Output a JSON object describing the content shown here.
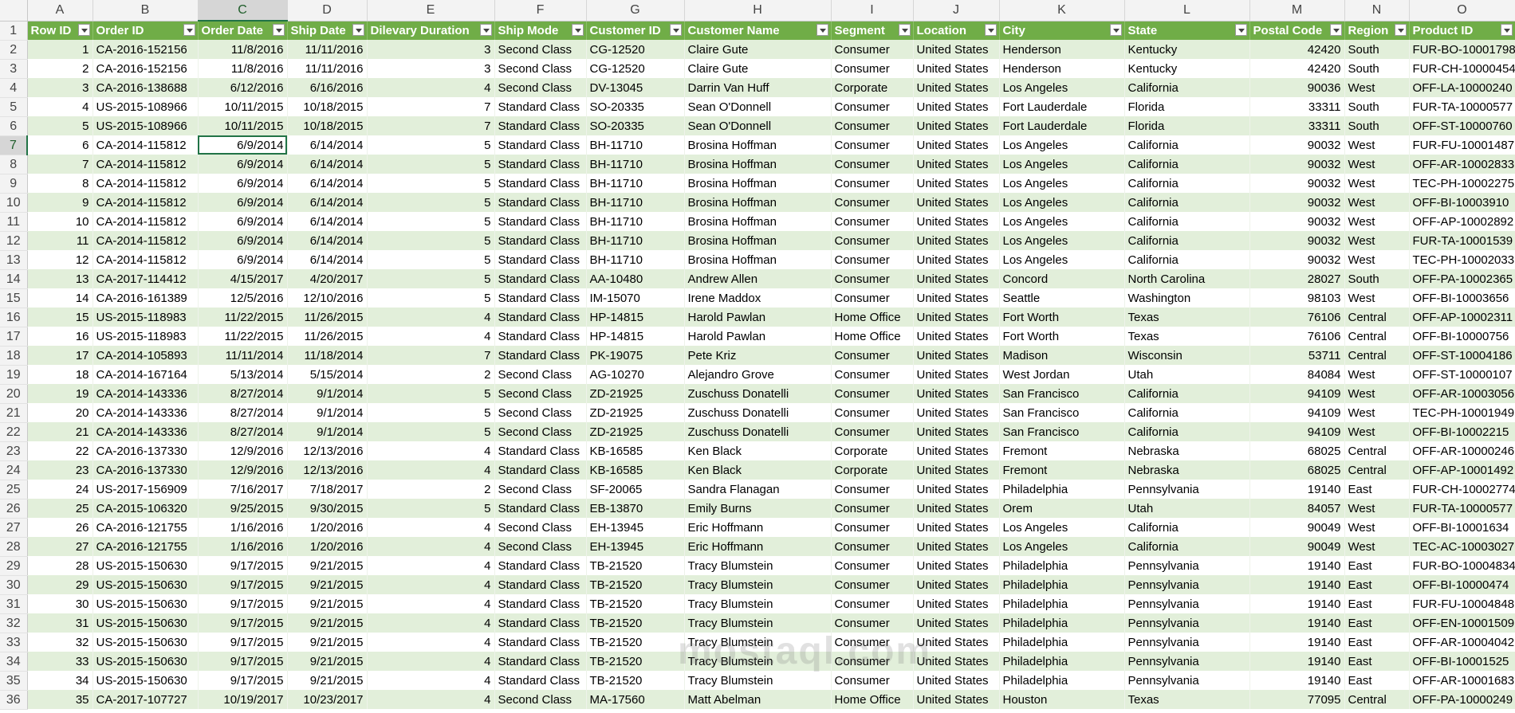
{
  "sheet": {
    "column_letters": [
      "A",
      "B",
      "C",
      "D",
      "E",
      "F",
      "G",
      "H",
      "I",
      "J",
      "K",
      "L",
      "M",
      "N",
      "O"
    ],
    "selected_column": "C",
    "selected_row": "7",
    "headers": [
      "Row ID",
      "Order ID",
      "Order Date",
      "Ship Date",
      "Dilevary Duration",
      "Ship Mode",
      "Customer ID",
      "Customer Name",
      "Segment",
      "Location",
      "City",
      "State",
      "Postal Code",
      "Region",
      "Product ID"
    ],
    "rows": [
      [
        "1",
        "CA-2016-152156",
        "11/8/2016",
        "11/11/2016",
        "3",
        "Second Class",
        "CG-12520",
        "Claire Gute",
        "Consumer",
        "United States",
        "Henderson",
        "Kentucky",
        "42420",
        "South",
        "FUR-BO-10001798"
      ],
      [
        "2",
        "CA-2016-152156",
        "11/8/2016",
        "11/11/2016",
        "3",
        "Second Class",
        "CG-12520",
        "Claire Gute",
        "Consumer",
        "United States",
        "Henderson",
        "Kentucky",
        "42420",
        "South",
        "FUR-CH-10000454"
      ],
      [
        "3",
        "CA-2016-138688",
        "6/12/2016",
        "6/16/2016",
        "4",
        "Second Class",
        "DV-13045",
        "Darrin Van Huff",
        "Corporate",
        "United States",
        "Los Angeles",
        "California",
        "90036",
        "West",
        "OFF-LA-10000240"
      ],
      [
        "4",
        "US-2015-108966",
        "10/11/2015",
        "10/18/2015",
        "7",
        "Standard Class",
        "SO-20335",
        "Sean O'Donnell",
        "Consumer",
        "United States",
        "Fort Lauderdale",
        "Florida",
        "33311",
        "South",
        "FUR-TA-10000577"
      ],
      [
        "5",
        "US-2015-108966",
        "10/11/2015",
        "10/18/2015",
        "7",
        "Standard Class",
        "SO-20335",
        "Sean O'Donnell",
        "Consumer",
        "United States",
        "Fort Lauderdale",
        "Florida",
        "33311",
        "South",
        "OFF-ST-10000760"
      ],
      [
        "6",
        "CA-2014-115812",
        "6/9/2014",
        "6/14/2014",
        "5",
        "Standard Class",
        "BH-11710",
        "Brosina Hoffman",
        "Consumer",
        "United States",
        "Los Angeles",
        "California",
        "90032",
        "West",
        "FUR-FU-10001487"
      ],
      [
        "7",
        "CA-2014-115812",
        "6/9/2014",
        "6/14/2014",
        "5",
        "Standard Class",
        "BH-11710",
        "Brosina Hoffman",
        "Consumer",
        "United States",
        "Los Angeles",
        "California",
        "90032",
        "West",
        "OFF-AR-10002833"
      ],
      [
        "8",
        "CA-2014-115812",
        "6/9/2014",
        "6/14/2014",
        "5",
        "Standard Class",
        "BH-11710",
        "Brosina Hoffman",
        "Consumer",
        "United States",
        "Los Angeles",
        "California",
        "90032",
        "West",
        "TEC-PH-10002275"
      ],
      [
        "9",
        "CA-2014-115812",
        "6/9/2014",
        "6/14/2014",
        "5",
        "Standard Class",
        "BH-11710",
        "Brosina Hoffman",
        "Consumer",
        "United States",
        "Los Angeles",
        "California",
        "90032",
        "West",
        "OFF-BI-10003910"
      ],
      [
        "10",
        "CA-2014-115812",
        "6/9/2014",
        "6/14/2014",
        "5",
        "Standard Class",
        "BH-11710",
        "Brosina Hoffman",
        "Consumer",
        "United States",
        "Los Angeles",
        "California",
        "90032",
        "West",
        "OFF-AP-10002892"
      ],
      [
        "11",
        "CA-2014-115812",
        "6/9/2014",
        "6/14/2014",
        "5",
        "Standard Class",
        "BH-11710",
        "Brosina Hoffman",
        "Consumer",
        "United States",
        "Los Angeles",
        "California",
        "90032",
        "West",
        "FUR-TA-10001539"
      ],
      [
        "12",
        "CA-2014-115812",
        "6/9/2014",
        "6/14/2014",
        "5",
        "Standard Class",
        "BH-11710",
        "Brosina Hoffman",
        "Consumer",
        "United States",
        "Los Angeles",
        "California",
        "90032",
        "West",
        "TEC-PH-10002033"
      ],
      [
        "13",
        "CA-2017-114412",
        "4/15/2017",
        "4/20/2017",
        "5",
        "Standard Class",
        "AA-10480",
        "Andrew Allen",
        "Consumer",
        "United States",
        "Concord",
        "North Carolina",
        "28027",
        "South",
        "OFF-PA-10002365"
      ],
      [
        "14",
        "CA-2016-161389",
        "12/5/2016",
        "12/10/2016",
        "5",
        "Standard Class",
        "IM-15070",
        "Irene Maddox",
        "Consumer",
        "United States",
        "Seattle",
        "Washington",
        "98103",
        "West",
        "OFF-BI-10003656"
      ],
      [
        "15",
        "US-2015-118983",
        "11/22/2015",
        "11/26/2015",
        "4",
        "Standard Class",
        "HP-14815",
        "Harold Pawlan",
        "Home Office",
        "United States",
        "Fort Worth",
        "Texas",
        "76106",
        "Central",
        "OFF-AP-10002311"
      ],
      [
        "16",
        "US-2015-118983",
        "11/22/2015",
        "11/26/2015",
        "4",
        "Standard Class",
        "HP-14815",
        "Harold Pawlan",
        "Home Office",
        "United States",
        "Fort Worth",
        "Texas",
        "76106",
        "Central",
        "OFF-BI-10000756"
      ],
      [
        "17",
        "CA-2014-105893",
        "11/11/2014",
        "11/18/2014",
        "7",
        "Standard Class",
        "PK-19075",
        "Pete Kriz",
        "Consumer",
        "United States",
        "Madison",
        "Wisconsin",
        "53711",
        "Central",
        "OFF-ST-10004186"
      ],
      [
        "18",
        "CA-2014-167164",
        "5/13/2014",
        "5/15/2014",
        "2",
        "Second Class",
        "AG-10270",
        "Alejandro Grove",
        "Consumer",
        "United States",
        "West Jordan",
        "Utah",
        "84084",
        "West",
        "OFF-ST-10000107"
      ],
      [
        "19",
        "CA-2014-143336",
        "8/27/2014",
        "9/1/2014",
        "5",
        "Second Class",
        "ZD-21925",
        "Zuschuss Donatelli",
        "Consumer",
        "United States",
        "San Francisco",
        "California",
        "94109",
        "West",
        "OFF-AR-10003056"
      ],
      [
        "20",
        "CA-2014-143336",
        "8/27/2014",
        "9/1/2014",
        "5",
        "Second Class",
        "ZD-21925",
        "Zuschuss Donatelli",
        "Consumer",
        "United States",
        "San Francisco",
        "California",
        "94109",
        "West",
        "TEC-PH-10001949"
      ],
      [
        "21",
        "CA-2014-143336",
        "8/27/2014",
        "9/1/2014",
        "5",
        "Second Class",
        "ZD-21925",
        "Zuschuss Donatelli",
        "Consumer",
        "United States",
        "San Francisco",
        "California",
        "94109",
        "West",
        "OFF-BI-10002215"
      ],
      [
        "22",
        "CA-2016-137330",
        "12/9/2016",
        "12/13/2016",
        "4",
        "Standard Class",
        "KB-16585",
        "Ken Black",
        "Corporate",
        "United States",
        "Fremont",
        "Nebraska",
        "68025",
        "Central",
        "OFF-AR-10000246"
      ],
      [
        "23",
        "CA-2016-137330",
        "12/9/2016",
        "12/13/2016",
        "4",
        "Standard Class",
        "KB-16585",
        "Ken Black",
        "Corporate",
        "United States",
        "Fremont",
        "Nebraska",
        "68025",
        "Central",
        "OFF-AP-10001492"
      ],
      [
        "24",
        "US-2017-156909",
        "7/16/2017",
        "7/18/2017",
        "2",
        "Second Class",
        "SF-20065",
        "Sandra Flanagan",
        "Consumer",
        "United States",
        "Philadelphia",
        "Pennsylvania",
        "19140",
        "East",
        "FUR-CH-10002774"
      ],
      [
        "25",
        "CA-2015-106320",
        "9/25/2015",
        "9/30/2015",
        "5",
        "Standard Class",
        "EB-13870",
        "Emily Burns",
        "Consumer",
        "United States",
        "Orem",
        "Utah",
        "84057",
        "West",
        "FUR-TA-10000577"
      ],
      [
        "26",
        "CA-2016-121755",
        "1/16/2016",
        "1/20/2016",
        "4",
        "Second Class",
        "EH-13945",
        "Eric Hoffmann",
        "Consumer",
        "United States",
        "Los Angeles",
        "California",
        "90049",
        "West",
        "OFF-BI-10001634"
      ],
      [
        "27",
        "CA-2016-121755",
        "1/16/2016",
        "1/20/2016",
        "4",
        "Second Class",
        "EH-13945",
        "Eric Hoffmann",
        "Consumer",
        "United States",
        "Los Angeles",
        "California",
        "90049",
        "West",
        "TEC-AC-10003027"
      ],
      [
        "28",
        "US-2015-150630",
        "9/17/2015",
        "9/21/2015",
        "4",
        "Standard Class",
        "TB-21520",
        "Tracy Blumstein",
        "Consumer",
        "United States",
        "Philadelphia",
        "Pennsylvania",
        "19140",
        "East",
        "FUR-BO-10004834"
      ],
      [
        "29",
        "US-2015-150630",
        "9/17/2015",
        "9/21/2015",
        "4",
        "Standard Class",
        "TB-21520",
        "Tracy Blumstein",
        "Consumer",
        "United States",
        "Philadelphia",
        "Pennsylvania",
        "19140",
        "East",
        "OFF-BI-10000474"
      ],
      [
        "30",
        "US-2015-150630",
        "9/17/2015",
        "9/21/2015",
        "4",
        "Standard Class",
        "TB-21520",
        "Tracy Blumstein",
        "Consumer",
        "United States",
        "Philadelphia",
        "Pennsylvania",
        "19140",
        "East",
        "FUR-FU-10004848"
      ],
      [
        "31",
        "US-2015-150630",
        "9/17/2015",
        "9/21/2015",
        "4",
        "Standard Class",
        "TB-21520",
        "Tracy Blumstein",
        "Consumer",
        "United States",
        "Philadelphia",
        "Pennsylvania",
        "19140",
        "East",
        "OFF-EN-10001509"
      ],
      [
        "32",
        "US-2015-150630",
        "9/17/2015",
        "9/21/2015",
        "4",
        "Standard Class",
        "TB-21520",
        "Tracy Blumstein",
        "Consumer",
        "United States",
        "Philadelphia",
        "Pennsylvania",
        "19140",
        "East",
        "OFF-AR-10004042"
      ],
      [
        "33",
        "US-2015-150630",
        "9/17/2015",
        "9/21/2015",
        "4",
        "Standard Class",
        "TB-21520",
        "Tracy Blumstein",
        "Consumer",
        "United States",
        "Philadelphia",
        "Pennsylvania",
        "19140",
        "East",
        "OFF-BI-10001525"
      ],
      [
        "34",
        "US-2015-150630",
        "9/17/2015",
        "9/21/2015",
        "4",
        "Standard Class",
        "TB-21520",
        "Tracy Blumstein",
        "Consumer",
        "United States",
        "Philadelphia",
        "Pennsylvania",
        "19140",
        "East",
        "OFF-AR-10001683"
      ],
      [
        "35",
        "CA-2017-107727",
        "10/19/2017",
        "10/23/2017",
        "4",
        "Second Class",
        "MA-17560",
        "Matt Abelman",
        "Home Office",
        "United States",
        "Houston",
        "Texas",
        "77095",
        "Central",
        "OFF-PA-10000249"
      ]
    ],
    "watermark": "mostaql.com"
  },
  "colors": {
    "header_fill": "#70ad47",
    "band_fill": "#e2efda",
    "selection": "#217346"
  }
}
